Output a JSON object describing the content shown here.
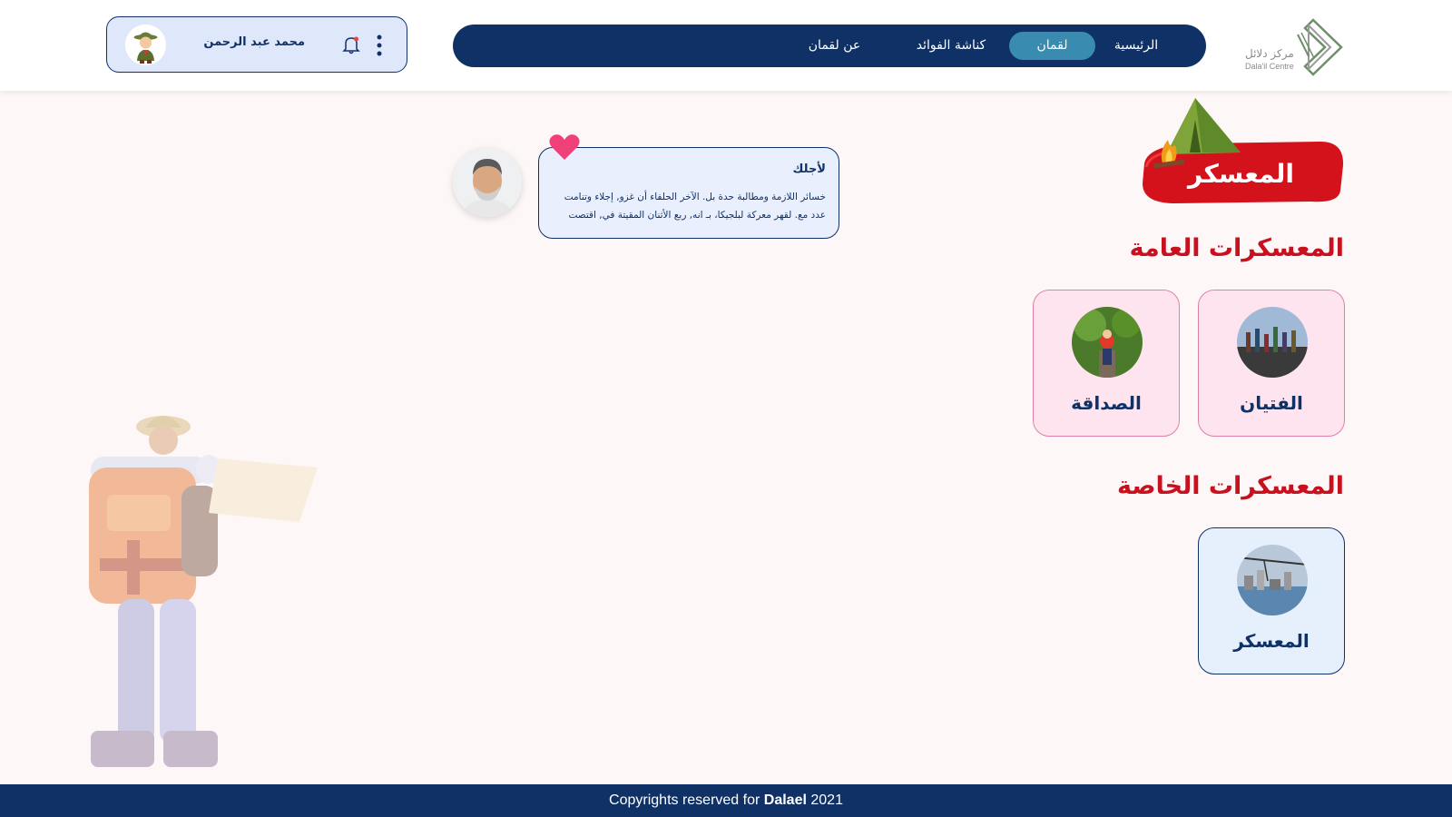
{
  "header": {
    "logo": {
      "name_ar": "مركز دلائل",
      "name_en": "Dala'il Centre"
    },
    "nav": [
      {
        "label": "الرئيسية",
        "active": false
      },
      {
        "label": "لقمان",
        "active": true
      },
      {
        "label": "كناشة الفوائد",
        "active": false
      },
      {
        "label": "عن لقمان",
        "active": false
      }
    ],
    "user": {
      "name": "محمد عبد الرحمن"
    }
  },
  "hero": {
    "title": "المعسكر"
  },
  "sections": {
    "public": {
      "title": "المعسكرات العامة",
      "cards": [
        {
          "label": "الفتيان",
          "image": "group-photo"
        },
        {
          "label": "الصداقة",
          "image": "friends-photo"
        }
      ]
    },
    "private": {
      "title": "المعسكرات الخاصة",
      "cards": [
        {
          "label": "المعسكر",
          "image": "city-photo"
        }
      ]
    }
  },
  "bubble": {
    "title": "لأجلك",
    "line1": "خسائر اللازمة ومطالبة حدة بل. الآخر الحلفاء أن غزو, إجلاء وتنامت",
    "line2": "عدد مع. لقهر معركة لبلجيكا، بـ انه, ربع الأثنان المقيتة في, اقتصت"
  },
  "footer": {
    "prefix": "Copyrights reserved for",
    "brand": "Dalael",
    "year": "2021"
  },
  "colors": {
    "navy": "#0f3166",
    "red": "#c8101e",
    "pink_card": "#fde4ef",
    "blue_card": "#e6effc",
    "active_tab": "#3a8bb0",
    "heart": "#f0407a"
  }
}
